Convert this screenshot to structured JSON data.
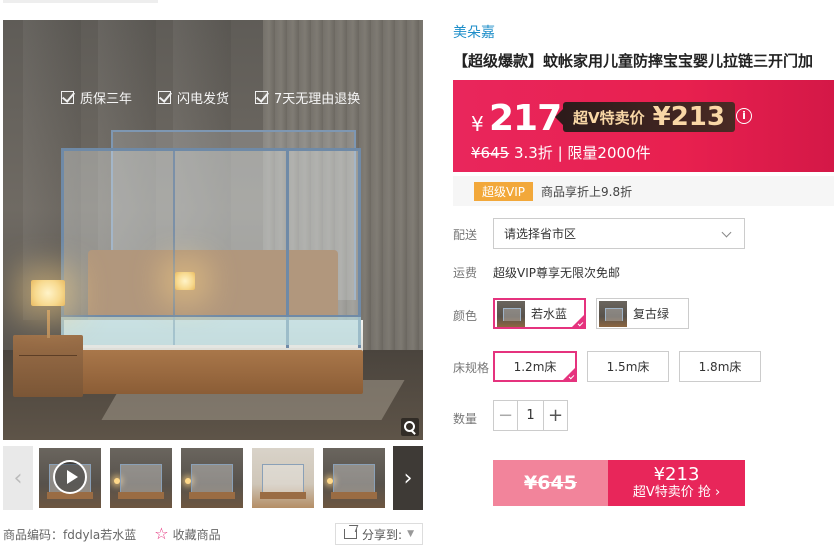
{
  "gallery": {
    "promises": [
      "质保三年",
      "闪电发货",
      "7天无理由退换"
    ],
    "thumb_count": 6
  },
  "meta": {
    "sku_code": "商品编码：fddyla若水蓝",
    "favorite": "收藏商品",
    "share": "分享到:"
  },
  "product": {
    "brand": "美朵嘉",
    "title": "【超级爆款】蚊帐家用儿童防摔宝宝婴儿拉链三开门加"
  },
  "price": {
    "currency": "¥",
    "now": "217",
    "svip_label": "超V特卖价",
    "svip_price": "¥213",
    "original": "¥645",
    "sub": " 3.3折 | 限量2000件",
    "info_icon": "i"
  },
  "vip": {
    "badge": "超级VIP",
    "text": "商品享折上9.8折"
  },
  "delivery": {
    "label": "配送",
    "placeholder": "请选择省市区"
  },
  "shipping": {
    "label": "运费",
    "text": "超级VIP尊享无限次免邮"
  },
  "color": {
    "label": "颜色",
    "options": [
      "若水蓝",
      "复古绿"
    ],
    "selected": "若水蓝"
  },
  "size": {
    "label": "床规格",
    "options": [
      "1.2m床",
      "1.5m床",
      "1.8m床"
    ],
    "selected": "1.2m床"
  },
  "quantity": {
    "label": "数量",
    "value": "1",
    "minus": "−",
    "plus": "+"
  },
  "buy": {
    "original": "¥645",
    "price": "¥213",
    "label": "超V特卖价 抢 ›"
  },
  "colors": {
    "accent": "#e8265a",
    "brand_link": "#1e8ec9",
    "vip_gold": "#f2a83a"
  }
}
